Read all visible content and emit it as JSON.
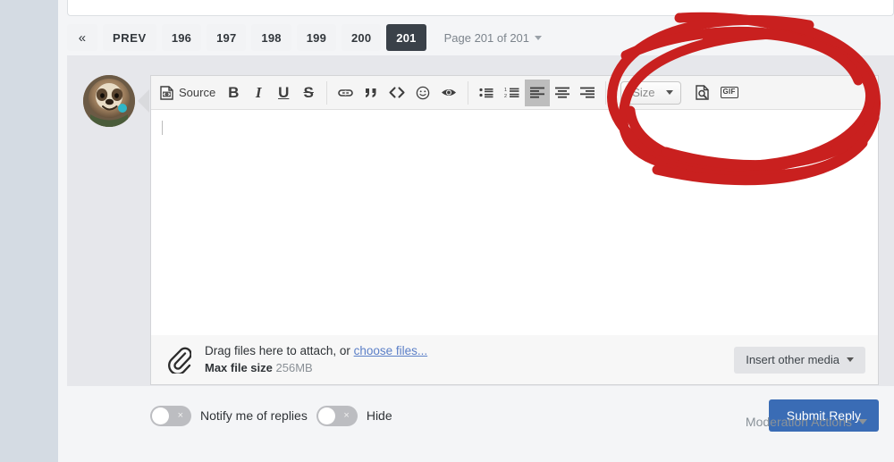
{
  "pagination": {
    "first_label": "«",
    "prev_label": "PREV",
    "pages": [
      "196",
      "197",
      "198",
      "199",
      "200",
      "201"
    ],
    "active_page": "201",
    "indicator": "Page 201 of 201"
  },
  "editor": {
    "toolbar": {
      "source_label": "Source",
      "bold_label": "B",
      "italic_label": "I",
      "underline_label": "U",
      "strike_label": "S",
      "size_label": "Size",
      "gif_label": "GIF",
      "icons": [
        "source-icon",
        "link-icon",
        "quote-icon",
        "code-icon",
        "emoji-icon",
        "spoiler-eye-icon",
        "bullet-list-icon",
        "numbered-list-icon",
        "align-left-icon",
        "align-center-icon",
        "align-right-icon",
        "preview-document-icon",
        "gif-icon"
      ],
      "active_button": "align-left-icon"
    },
    "body_value": "",
    "body_placeholder": ""
  },
  "attachments": {
    "drag_text_prefix": "Drag files here to attach, or ",
    "choose_files_label": "choose files...",
    "max_size_label": "Max file size",
    "max_size_value": "256MB",
    "insert_media_label": "Insert other media"
  },
  "options": {
    "notify_label": "Notify me of replies",
    "notify_state": "off",
    "hide_label": "Hide",
    "hide_state": "off",
    "toggle_off_glyph": "×"
  },
  "actions": {
    "submit_label": "Submit Reply",
    "moderation_label": "Moderation Actions"
  },
  "avatar": {
    "name": "sloth-avatar"
  },
  "colors": {
    "accent_blue": "#3a6cb5",
    "active_page_bg": "#3a4149",
    "link_blue": "#5b7fc7",
    "annotation_red": "#c9201f",
    "page_bg": "#f4f5f7",
    "outer_bg": "#d4dbe3",
    "reply_bg": "#e6e7eb"
  }
}
